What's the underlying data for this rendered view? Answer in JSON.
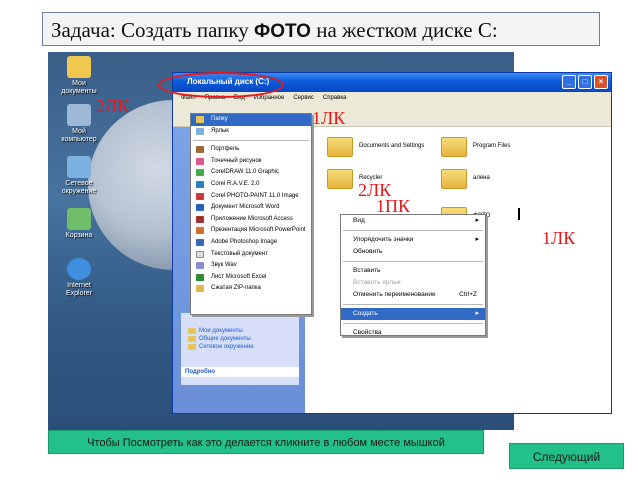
{
  "task": {
    "prefix": "Задача: Создать папку ",
    "bold": "ФОТО",
    "suffix": " на жестком диске С:"
  },
  "desktop_icons": [
    "Мои документы",
    "Мой компьютер",
    "Сетевое окружение",
    "Корзина",
    "Internet Explorer"
  ],
  "explorer": {
    "title": "Локальный диск (C:)",
    "menu": [
      "Файл",
      "Правка",
      "Вид",
      "Избранное",
      "Сервис",
      "Справка"
    ],
    "side_links": [
      "Мои документы",
      "Общие документы",
      "Сетевое окружение"
    ],
    "details_header": "Подробно",
    "folders": [
      "Documents and Settings",
      "Program Files",
      "Recycler",
      "алена",
      "ФОТО"
    ]
  },
  "create_submenu": {
    "items": [
      "Папку",
      "Ярлык",
      "Портфель",
      "Точечный рисунок",
      "CorelDRAW 11.0 Graphic",
      "Corel R.A.V.E. 2.0",
      "Corel PHOTO-PAINT 11.0 Image",
      "Документ Microsoft Word",
      "Приложение Microsoft Access",
      "Презентация Microsoft PowerPoint",
      "Adobe Photoshop Image",
      "Текстовый документ",
      "Звук Wav",
      "Лист Microsoft Excel",
      "Сжатая ZIP-папка"
    ]
  },
  "context_menu": {
    "view": "Вид",
    "arrange": "Упорядочить значки",
    "refresh": "Обновить",
    "paste": "Вставить",
    "paste_shortcut": "Вставить ярлык",
    "undo": "Отменить переименование",
    "undo_key": "Ctrl+Z",
    "create": "Создать",
    "properties": "Свойства"
  },
  "annotations": {
    "lk1": "1ЛК",
    "lk2": "2ЛК",
    "pk1": "1ПК"
  },
  "footer": {
    "hint": "Чтобы Посмотреть как это делается кликните в любом месте мышкой",
    "next": "Следующий"
  },
  "colors": {
    "highlight": "#316ac5",
    "annotation_red": "#e8181c",
    "button_green": "#24c08a"
  }
}
